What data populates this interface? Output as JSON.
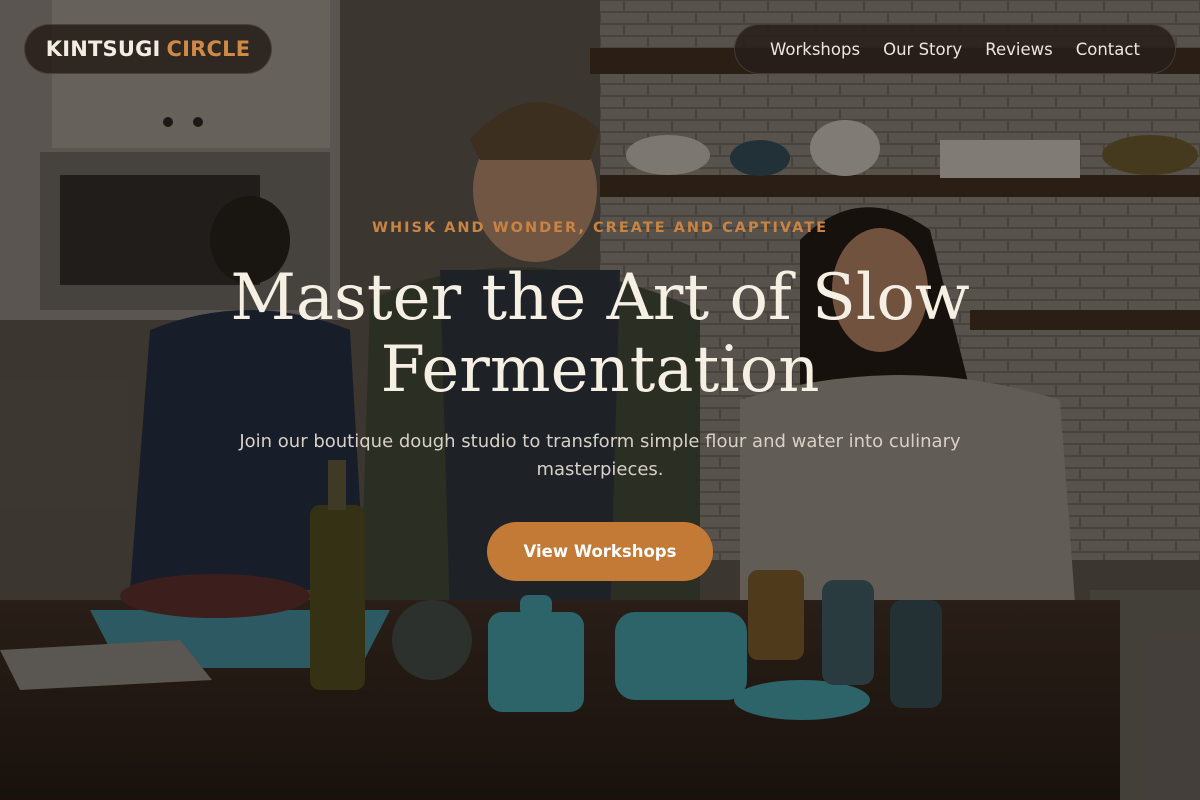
{
  "brand": {
    "name_primary": "KINTSUGI",
    "name_accent": "CIRCLE"
  },
  "nav": {
    "items": [
      {
        "label": "Workshops"
      },
      {
        "label": "Our Story"
      },
      {
        "label": "Reviews"
      },
      {
        "label": "Contact"
      }
    ]
  },
  "hero": {
    "eyebrow": "WHISK AND WONDER, CREATE AND CAPTIVATE",
    "title": "Master the Art of Slow Fermentation",
    "subtitle": "Join our boutique dough studio to transform simple flour and water into culinary masterpieces.",
    "cta_label": "View Workshops",
    "background_icon": "kitchen-photo"
  },
  "colors": {
    "accent": "#c47a37",
    "accent_text": "#c98443",
    "pill_bg": "#281f1a",
    "title_text": "#f6efe3"
  }
}
